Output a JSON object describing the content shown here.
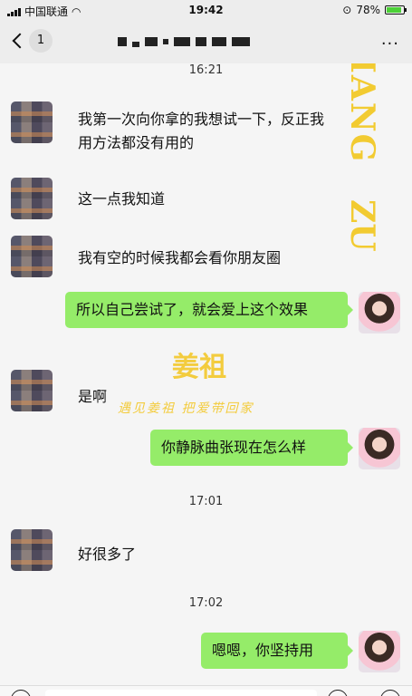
{
  "status_bar": {
    "carrier": "中国联通",
    "time": "19:42",
    "battery": "78%",
    "battery_level": 0.78
  },
  "nav": {
    "unread_count": "1",
    "more_label": "···"
  },
  "watermark": {
    "brand_vertical_top": "IANG",
    "brand_vertical_bottom": "ZU",
    "brand_cn": "姜祖",
    "slogan": "遇见姜祖   把爱带回家"
  },
  "chat": {
    "timestamps": [
      "16:21",
      "17:01",
      "17:02"
    ],
    "messages": [
      {
        "side": "in",
        "text": "我第一次向你拿的我想试一下，反正我用方法都没有用的"
      },
      {
        "side": "in",
        "text": "这一点我知道"
      },
      {
        "side": "in",
        "text": "我有空的时候我都会看你朋友圈"
      },
      {
        "side": "out",
        "text": "所以自己尝试了，就会爱上这个效果"
      },
      {
        "side": "in",
        "text": "是啊"
      },
      {
        "side": "out",
        "text": "你静脉曲张现在怎么样"
      },
      {
        "side": "in",
        "text": "好很多了"
      },
      {
        "side": "out",
        "text": "嗯嗯，你坚持用"
      }
    ]
  },
  "colors": {
    "outgoing_bubble": "#95ec69",
    "incoming_bubble": "#ffffff",
    "watermark": "#f2c410"
  }
}
